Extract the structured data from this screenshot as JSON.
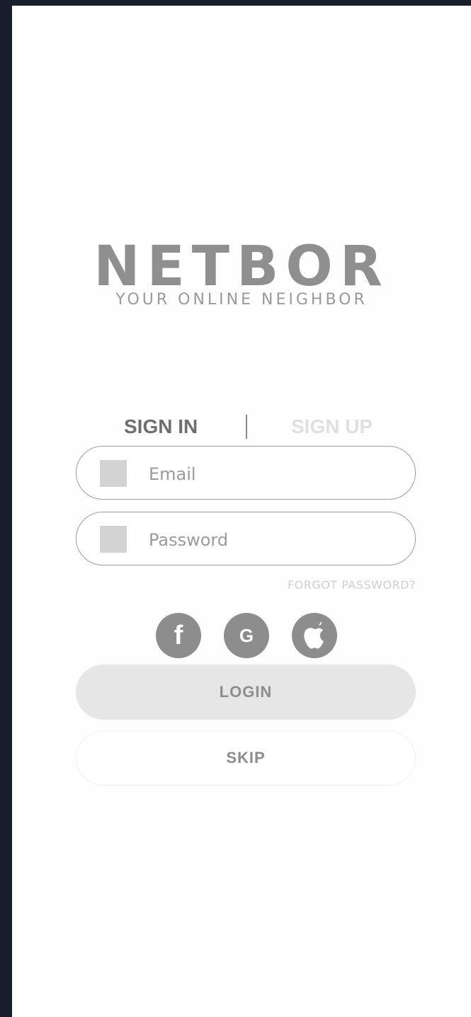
{
  "logo": {
    "title": "NETBOR",
    "tagline": "YOUR ONLINE NEIGHBOR"
  },
  "tabs": {
    "signin": "SIGN IN",
    "signup": "SIGN UP"
  },
  "form": {
    "email_placeholder": "Email",
    "email_value": "",
    "password_placeholder": "Password",
    "password_value": ""
  },
  "forgot_password": "FORGOT PASSWORD?",
  "social": {
    "facebook_glyph": "f",
    "google_glyph": "G",
    "apple_icon": "apple-icon"
  },
  "buttons": {
    "login": "LOGIN",
    "skip": "SKIP"
  }
}
